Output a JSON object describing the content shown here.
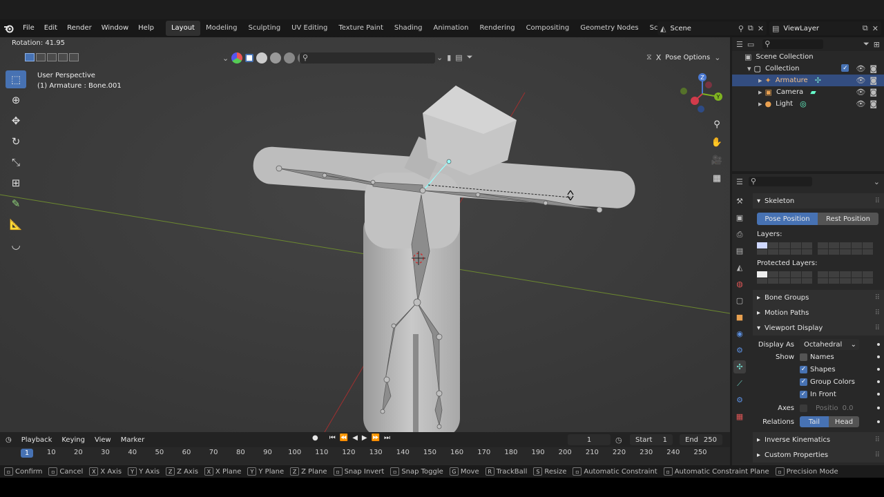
{
  "menu": [
    "File",
    "Edit",
    "Render",
    "Window",
    "Help"
  ],
  "workspaces": [
    "Layout",
    "Modeling",
    "Sculpting",
    "UV Editing",
    "Texture Paint",
    "Shading",
    "Animation",
    "Rendering",
    "Compositing",
    "Geometry Nodes",
    "Scripting"
  ],
  "active_workspace": "Layout",
  "scene": "Scene",
  "view_layer": "ViewLayer",
  "viewport": {
    "rotation": "Rotation: 41.95",
    "perspective": "User Perspective",
    "object": "(1) Armature : Bone.001",
    "pose_options": "Pose Options",
    "gizmo": {
      "z": "Z",
      "y": "Y"
    }
  },
  "outliner": {
    "rows": [
      {
        "label": "Scene Collection"
      },
      {
        "label": "Collection"
      },
      {
        "label": "Armature"
      },
      {
        "label": "Camera"
      },
      {
        "label": "Light"
      }
    ]
  },
  "properties": {
    "skeleton": "Skeleton",
    "pose_position": "Pose Position",
    "rest_position": "Rest Position",
    "layers": "Layers:",
    "protected_layers": "Protected Layers:",
    "bone_groups": "Bone Groups",
    "motion_paths": "Motion Paths",
    "viewport_display": "Viewport Display",
    "display_as_label": "Display As",
    "display_as_value": "Octahedral",
    "show_label": "Show",
    "names": "Names",
    "shapes": "Shapes",
    "group_colors": "Group Colors",
    "in_front": "In Front",
    "axes_label": "Axes",
    "axes_value": "Positio",
    "axes_num": "0.0",
    "relations_label": "Relations",
    "tail": "Tail",
    "head": "Head",
    "inverse_kinematics": "Inverse Kinematics",
    "custom_properties": "Custom Properties"
  },
  "timeline": {
    "menu": [
      "Playback",
      "Keying",
      "View",
      "Marker"
    ],
    "current_frame": "1",
    "start_label": "Start",
    "start": "1",
    "end_label": "End",
    "end": "250",
    "ticks": [
      "1",
      "10",
      "20",
      "30",
      "40",
      "50",
      "60",
      "70",
      "80",
      "90",
      "100",
      "110",
      "120",
      "130",
      "140",
      "150",
      "160",
      "170",
      "180",
      "190",
      "200",
      "210",
      "220",
      "230",
      "240",
      "250"
    ]
  },
  "status": [
    {
      "key": "",
      "label": "Confirm"
    },
    {
      "key": "",
      "label": "Cancel"
    },
    {
      "key": "X",
      "label": "X Axis"
    },
    {
      "key": "Y",
      "label": "Y Axis"
    },
    {
      "key": "Z",
      "label": "Z Axis"
    },
    {
      "key": "X",
      "label": "X Plane"
    },
    {
      "key": "Y",
      "label": "Y Plane"
    },
    {
      "key": "Z",
      "label": "Z Plane"
    },
    {
      "key": "",
      "label": "Snap Invert"
    },
    {
      "key": "",
      "label": "Snap Toggle"
    },
    {
      "key": "G",
      "label": "Move"
    },
    {
      "key": "R",
      "label": "TrackBall"
    },
    {
      "key": "S",
      "label": "Resize"
    },
    {
      "key": "",
      "label": "Automatic Constraint"
    },
    {
      "key": "",
      "label": "Automatic Constraint Plane"
    },
    {
      "key": "",
      "label": "Precision Mode"
    }
  ]
}
